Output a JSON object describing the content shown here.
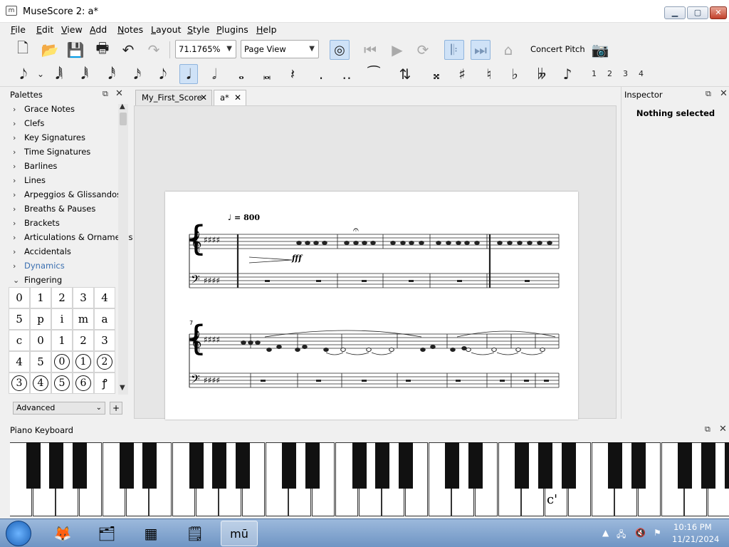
{
  "window": {
    "title": "MuseScore 2: a*"
  },
  "menu": [
    {
      "label": "File",
      "u": "F",
      "rest": "ile"
    },
    {
      "label": "Edit",
      "u": "E",
      "rest": "dit"
    },
    {
      "label": "View",
      "u": "V",
      "rest": "iew"
    },
    {
      "label": "Add",
      "u": "A",
      "rest": "dd"
    },
    {
      "label": "Notes",
      "u": "N",
      "rest": "otes"
    },
    {
      "label": "Layout",
      "u": "L",
      "rest": "ayout"
    },
    {
      "label": "Style",
      "u": "S",
      "rest": "tyle"
    },
    {
      "label": "Plugins",
      "u": "P",
      "rest": "lugins"
    },
    {
      "label": "Help",
      "u": "H",
      "rest": "elp"
    }
  ],
  "toolbar": {
    "zoom": "71.1765%",
    "view_mode": "Page View",
    "concert_pitch": "Concert Pitch",
    "voices": [
      "1",
      "2",
      "3",
      "4"
    ]
  },
  "palettes": {
    "title": "Palettes",
    "items": [
      "Grace Notes",
      "Clefs",
      "Key Signatures",
      "Time Signatures",
      "Barlines",
      "Lines",
      "Arpeggios & Glissandos",
      "Breaths & Pauses",
      "Brackets",
      "Articulations & Ornaments",
      "Accidentals",
      "Dynamics",
      "Fingering"
    ],
    "expanded": "Fingering",
    "fingering": [
      "0",
      "1",
      "2",
      "3",
      "4",
      "5",
      "p",
      "i",
      "m",
      "a",
      "c",
      "0",
      "1",
      "2",
      "3",
      "4",
      "5",
      "0",
      "1",
      "2",
      "3",
      "4",
      "5",
      "6",
      "ꝭ"
    ],
    "circled_from": 17,
    "advanced": "Advanced",
    "add": "+"
  },
  "tabs": [
    {
      "label": "My_First_Score"
    },
    {
      "label": "a*"
    }
  ],
  "score": {
    "tempo": "♩ = 800",
    "dynamic": "fff",
    "measure_number": "7"
  },
  "inspector": {
    "title": "Inspector",
    "message": "Nothing selected"
  },
  "piano": {
    "title": "Piano Keyboard",
    "c_label": "c'"
  },
  "taskbar": {
    "time": "10:16 PM",
    "date": "11/21/2024"
  }
}
